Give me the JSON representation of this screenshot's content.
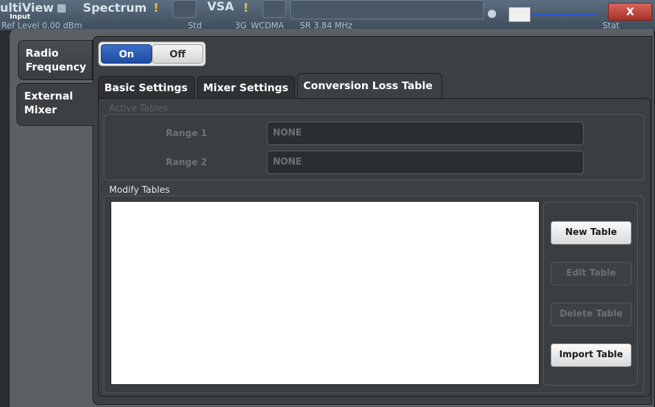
{
  "topbar": {
    "title_frag": "ultiView",
    "input_label": "Input",
    "spectrum_tab": "Spectrum",
    "spectrum_warn": "!",
    "vsa_tab": "VSA",
    "vsa_warn": "!",
    "ref_level": "Ref Level 0.00 dBm",
    "std": "Std",
    "standard": "3G_WCDMA",
    "sr": "SR 3.84 MHz",
    "close_label": "X",
    "stat_frag": "Stat"
  },
  "nav": {
    "radio_frequency": "Radio\nFrequency",
    "external_mixer": "External\nMixer"
  },
  "toggle": {
    "on_label": "On",
    "off_label": "Off",
    "state": "On"
  },
  "tabs": {
    "basic": "Basic Settings",
    "mixer": "Mixer Settings",
    "conversion": "Conversion Loss Table",
    "active": "Conversion Loss Table"
  },
  "active_tables": {
    "title": "Active Tables",
    "range1_label": "Range 1",
    "range1_value": "NONE",
    "range2_label": "Range 2",
    "range2_value": "NONE"
  },
  "modify_tables": {
    "title": "Modify Tables",
    "new_table": "New Table",
    "edit_table": "Edit Table",
    "delete_table": "Delete Table",
    "import_table": "Import Table"
  },
  "colors": {
    "accent": "#1f4aa0",
    "close": "#c0392b",
    "background": "#3c4043"
  }
}
